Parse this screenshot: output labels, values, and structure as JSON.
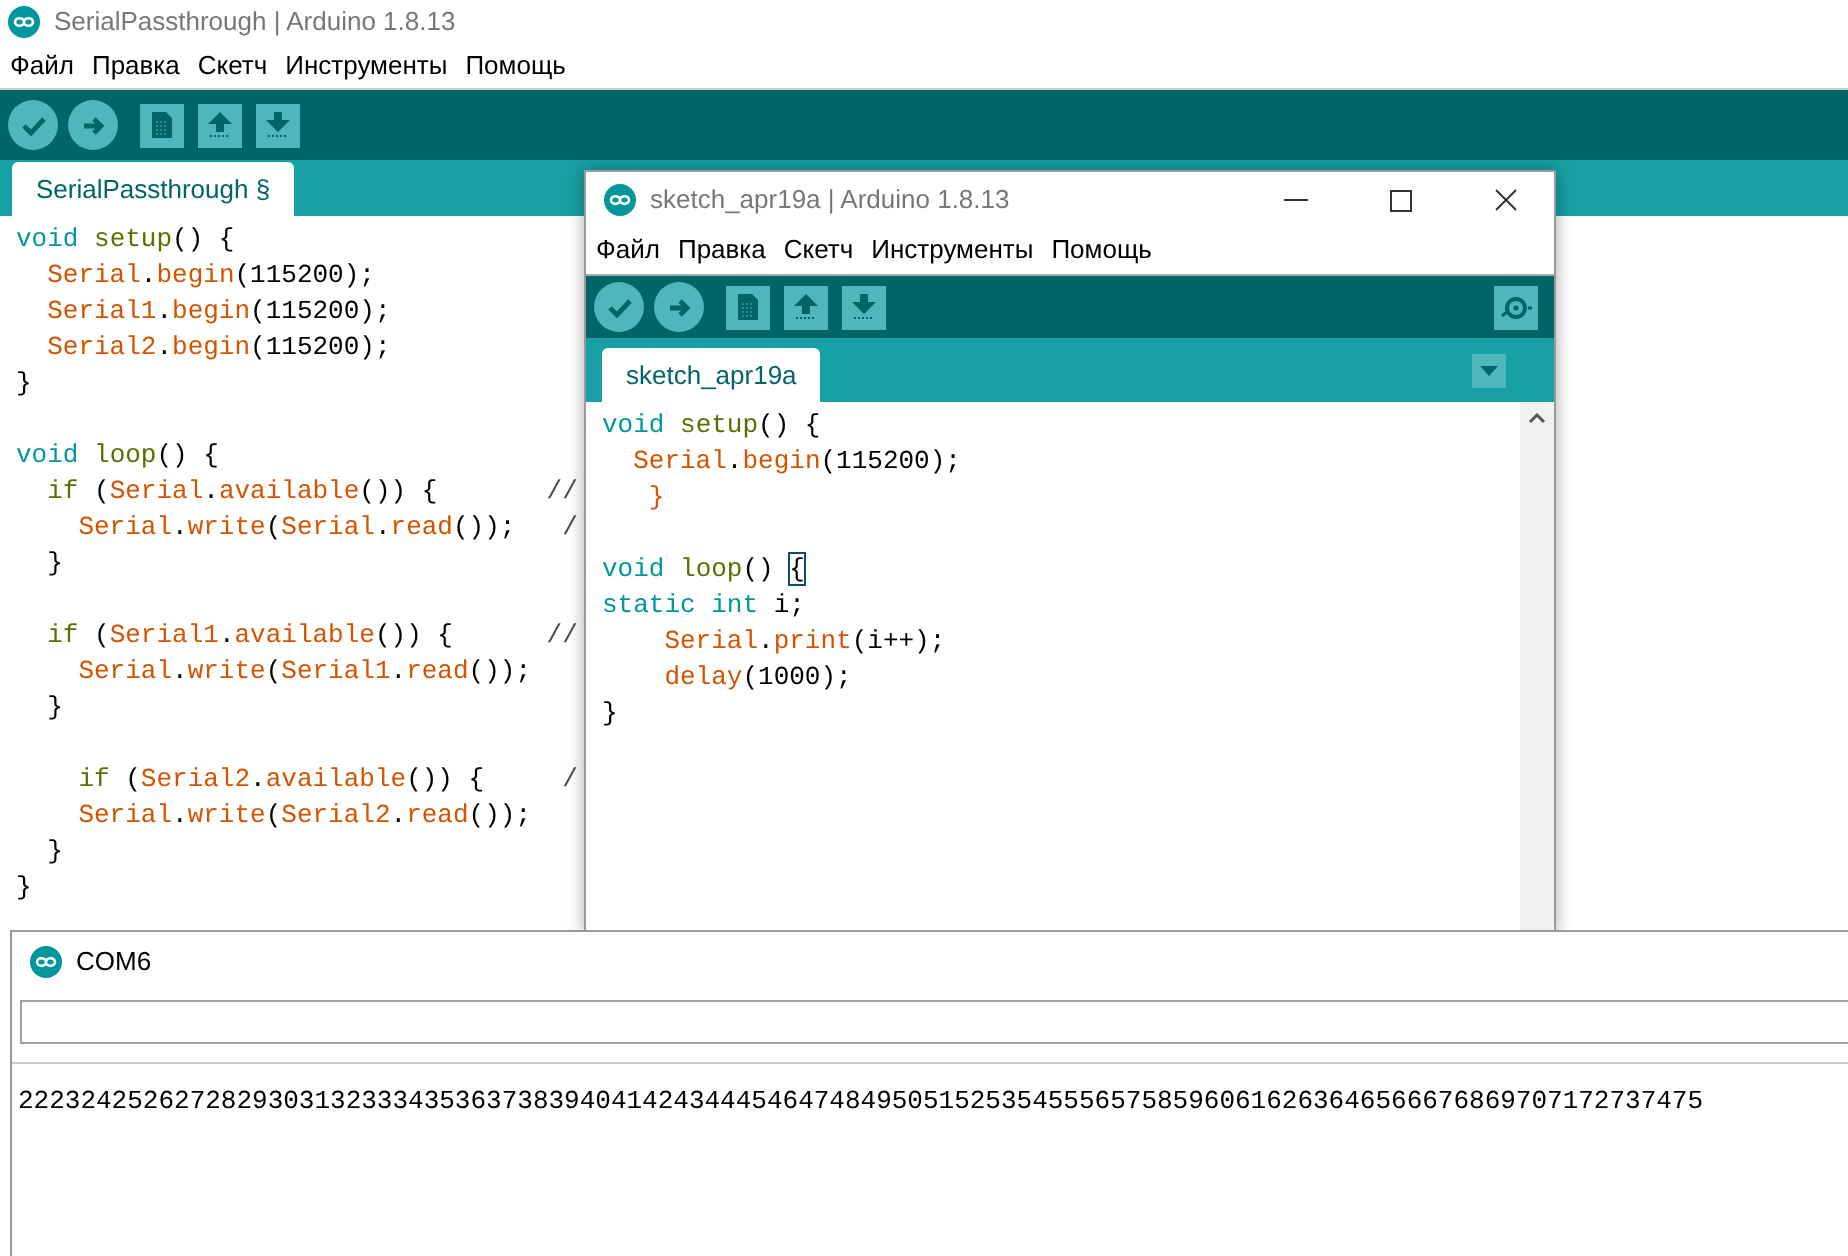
{
  "main_window": {
    "title": "SerialPassthrough | Arduino 1.8.13",
    "menu": [
      "Файл",
      "Правка",
      "Скетч",
      "Инструменты",
      "Помощь"
    ],
    "tabs": [
      {
        "label": "SerialPassthrough §",
        "selected": true
      }
    ],
    "code": [
      {
        "tokens": [
          {
            "text": "void",
            "kind": "kw"
          },
          {
            "text": " setup",
            "kind": "fn"
          },
          {
            "text": "() {",
            "kind": "plain"
          }
        ]
      },
      {
        "tokens": [
          {
            "text": "  Serial",
            "kind": "lib"
          },
          {
            "text": ".",
            "kind": "plain"
          },
          {
            "text": "begin",
            "kind": "lib"
          },
          {
            "text": "(115200);",
            "kind": "plain"
          }
        ]
      },
      {
        "tokens": [
          {
            "text": "  Serial1",
            "kind": "lib"
          },
          {
            "text": ".",
            "kind": "plain"
          },
          {
            "text": "begin",
            "kind": "lib"
          },
          {
            "text": "(115200);",
            "kind": "plain"
          }
        ]
      },
      {
        "tokens": [
          {
            "text": "  Serial2",
            "kind": "lib"
          },
          {
            "text": ".",
            "kind": "plain"
          },
          {
            "text": "begin",
            "kind": "lib"
          },
          {
            "text": "(115200);",
            "kind": "plain"
          }
        ]
      },
      {
        "tokens": [
          {
            "text": "}",
            "kind": "plain"
          }
        ]
      },
      {
        "gap_before": true,
        "tokens": [
          {
            "text": "void",
            "kind": "kw"
          },
          {
            "text": " loop",
            "kind": "fn"
          },
          {
            "text": "() {",
            "kind": "plain"
          }
        ]
      },
      {
        "tokens": [
          {
            "text": "  if",
            "kind": "fn"
          },
          {
            "text": " (",
            "kind": "plain"
          },
          {
            "text": "Serial",
            "kind": "lib"
          },
          {
            "text": ".",
            "kind": "plain"
          },
          {
            "text": "available",
            "kind": "lib"
          },
          {
            "text": "()) {",
            "kind": "plain"
          },
          {
            "text": "       //",
            "kind": "cm"
          }
        ]
      },
      {
        "tokens": [
          {
            "text": "    Serial",
            "kind": "lib"
          },
          {
            "text": ".",
            "kind": "plain"
          },
          {
            "text": "write",
            "kind": "lib"
          },
          {
            "text": "(",
            "kind": "plain"
          },
          {
            "text": "Serial",
            "kind": "lib"
          },
          {
            "text": ".",
            "kind": "plain"
          },
          {
            "text": "read",
            "kind": "lib"
          },
          {
            "text": "());",
            "kind": "plain"
          },
          {
            "text": "   /",
            "kind": "cm"
          }
        ]
      },
      {
        "tokens": [
          {
            "text": "  }",
            "kind": "plain"
          }
        ]
      },
      {
        "gap_before": true,
        "tokens": [
          {
            "text": "  if",
            "kind": "fn"
          },
          {
            "text": " (",
            "kind": "plain"
          },
          {
            "text": "Serial1",
            "kind": "lib"
          },
          {
            "text": ".",
            "kind": "plain"
          },
          {
            "text": "available",
            "kind": "lib"
          },
          {
            "text": "()) {",
            "kind": "plain"
          },
          {
            "text": "      //",
            "kind": "cm"
          }
        ]
      },
      {
        "tokens": [
          {
            "text": "    Serial",
            "kind": "lib"
          },
          {
            "text": ".",
            "kind": "plain"
          },
          {
            "text": "write",
            "kind": "lib"
          },
          {
            "text": "(",
            "kind": "plain"
          },
          {
            "text": "Serial1",
            "kind": "lib"
          },
          {
            "text": ".",
            "kind": "plain"
          },
          {
            "text": "read",
            "kind": "lib"
          },
          {
            "text": "());",
            "kind": "plain"
          }
        ]
      },
      {
        "tokens": [
          {
            "text": "  }",
            "kind": "plain"
          }
        ]
      },
      {
        "gap_before": true,
        "tokens": [
          {
            "text": "    if",
            "kind": "fn"
          },
          {
            "text": " (",
            "kind": "plain"
          },
          {
            "text": "Serial2",
            "kind": "lib"
          },
          {
            "text": ".",
            "kind": "plain"
          },
          {
            "text": "available",
            "kind": "lib"
          },
          {
            "text": "()) {",
            "kind": "plain"
          },
          {
            "text": "     /",
            "kind": "cm"
          }
        ]
      },
      {
        "tokens": [
          {
            "text": "    Serial",
            "kind": "lib"
          },
          {
            "text": ".",
            "kind": "plain"
          },
          {
            "text": "write",
            "kind": "lib"
          },
          {
            "text": "(",
            "kind": "plain"
          },
          {
            "text": "Serial2",
            "kind": "lib"
          },
          {
            "text": ".",
            "kind": "plain"
          },
          {
            "text": "read",
            "kind": "lib"
          },
          {
            "text": "());",
            "kind": "plain"
          }
        ]
      },
      {
        "tokens": [
          {
            "text": "  }",
            "kind": "plain"
          }
        ]
      },
      {
        "tokens": [
          {
            "text": "}",
            "kind": "plain"
          }
        ]
      }
    ]
  },
  "sketch_window": {
    "title": "sketch_apr19a | Arduino 1.8.13",
    "menu": [
      "Файл",
      "Правка",
      "Скетч",
      "Инструменты",
      "Помощь"
    ],
    "tabs": [
      {
        "label": "sketch_apr19a",
        "selected": true
      }
    ],
    "code": [
      {
        "tokens": [
          {
            "text": "void",
            "kind": "kw"
          },
          {
            "text": " setup",
            "kind": "fn"
          },
          {
            "text": "() {",
            "kind": "plain"
          }
        ]
      },
      {
        "tokens": [
          {
            "text": "  Serial",
            "kind": "lib"
          },
          {
            "text": ".",
            "kind": "plain"
          },
          {
            "text": "begin",
            "kind": "lib"
          },
          {
            "text": "(115200);",
            "kind": "plain"
          }
        ]
      },
      {
        "tokens": [
          {
            "text": "   }",
            "kind": "lib"
          }
        ]
      },
      {
        "gap_before": true,
        "tokens": [
          {
            "text": "void",
            "kind": "kw"
          },
          {
            "text": " loop",
            "kind": "fn"
          },
          {
            "text": "() ",
            "kind": "plain"
          },
          {
            "text": "{",
            "kind": "match"
          }
        ]
      },
      {
        "tokens": [
          {
            "text": "static",
            "kind": "kw"
          },
          {
            "text": " int",
            "kind": "kw"
          },
          {
            "text": " i;",
            "kind": "plain"
          }
        ]
      },
      {
        "tokens": [
          {
            "text": "    Serial",
            "kind": "lib"
          },
          {
            "text": ".",
            "kind": "plain"
          },
          {
            "text": "print",
            "kind": "lib"
          },
          {
            "text": "(i++);",
            "kind": "plain"
          }
        ]
      },
      {
        "tokens": [
          {
            "text": "    delay",
            "kind": "lib"
          },
          {
            "text": "(1000);",
            "kind": "plain"
          }
        ]
      },
      {
        "tokens": [
          {
            "text": "}",
            "kind": "plain"
          }
        ]
      }
    ]
  },
  "serial_monitor": {
    "title": "COM6",
    "output": "222324252627282930313233343536373839404142434445464748495051525354555657585960616263646566676869707172737475"
  }
}
